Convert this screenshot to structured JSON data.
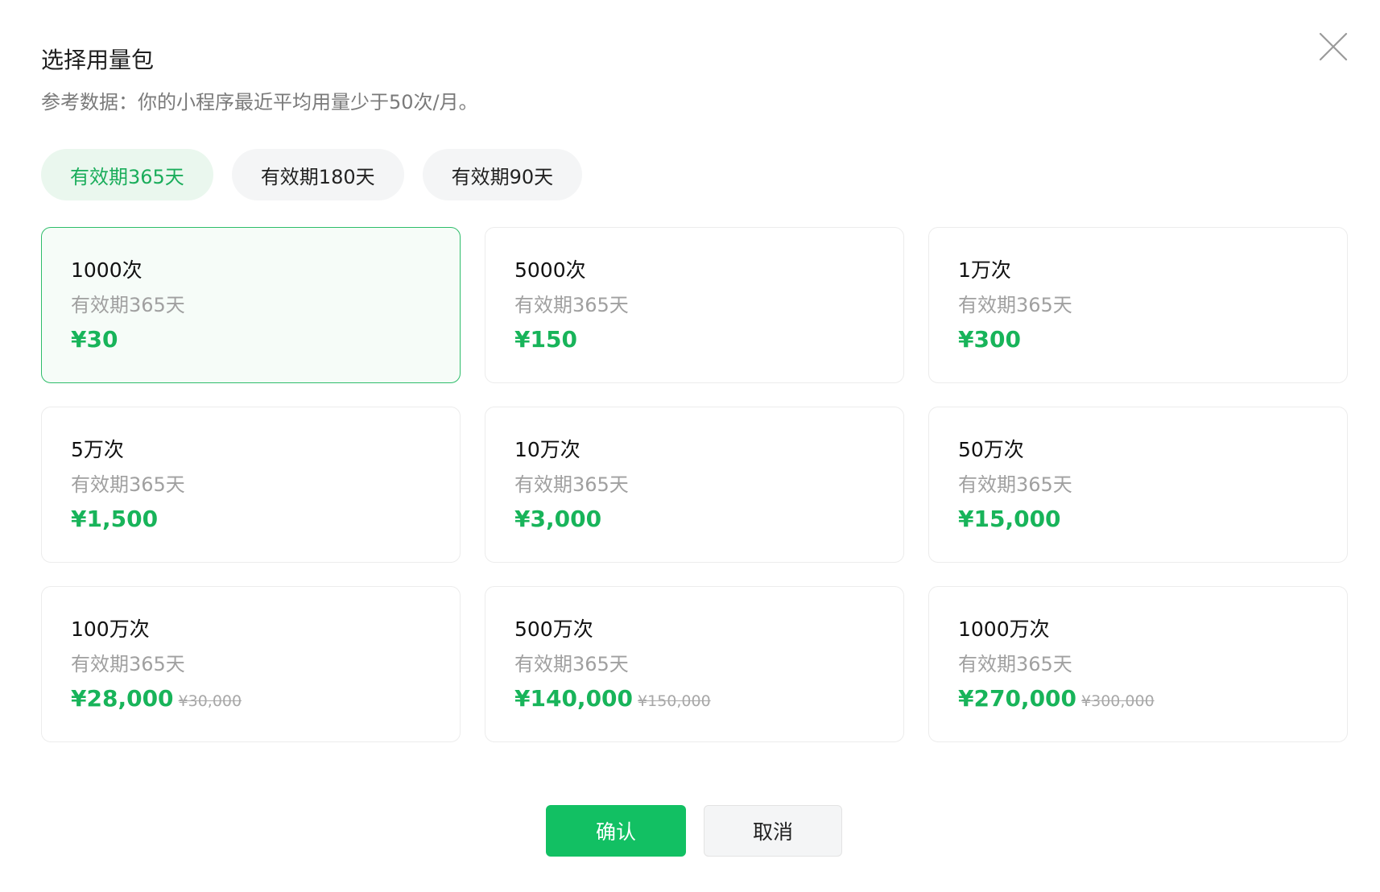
{
  "dialog": {
    "title": "选择用量包",
    "subtitle": "参考数据：你的小程序最近平均用量少于50次/月。",
    "close_icon": "close-icon"
  },
  "tabs": [
    {
      "label": "有效期365天",
      "active": true
    },
    {
      "label": "有效期180天",
      "active": false
    },
    {
      "label": "有效期90天",
      "active": false
    }
  ],
  "packages": [
    {
      "name": "1000次",
      "validity": "有效期365天",
      "price": "¥30",
      "original_price": "",
      "selected": true
    },
    {
      "name": "5000次",
      "validity": "有效期365天",
      "price": "¥150",
      "original_price": "",
      "selected": false
    },
    {
      "name": "1万次",
      "validity": "有效期365天",
      "price": "¥300",
      "original_price": "",
      "selected": false
    },
    {
      "name": "5万次",
      "validity": "有效期365天",
      "price": "¥1,500",
      "original_price": "",
      "selected": false
    },
    {
      "name": "10万次",
      "validity": "有效期365天",
      "price": "¥3,000",
      "original_price": "",
      "selected": false
    },
    {
      "name": "50万次",
      "validity": "有效期365天",
      "price": "¥15,000",
      "original_price": "",
      "selected": false
    },
    {
      "name": "100万次",
      "validity": "有效期365天",
      "price": "¥28,000",
      "original_price": "¥30,000",
      "selected": false
    },
    {
      "name": "500万次",
      "validity": "有效期365天",
      "price": "¥140,000",
      "original_price": "¥150,000",
      "selected": false
    },
    {
      "name": "1000万次",
      "validity": "有效期365天",
      "price": "¥270,000",
      "original_price": "¥300,000",
      "selected": false
    }
  ],
  "footer": {
    "confirm_label": "确认",
    "cancel_label": "取消"
  },
  "colors": {
    "accent": "#12c063",
    "price": "#18b45a",
    "tab_active_bg": "#eaf7ee",
    "selected_border": "#2ebd6a"
  }
}
